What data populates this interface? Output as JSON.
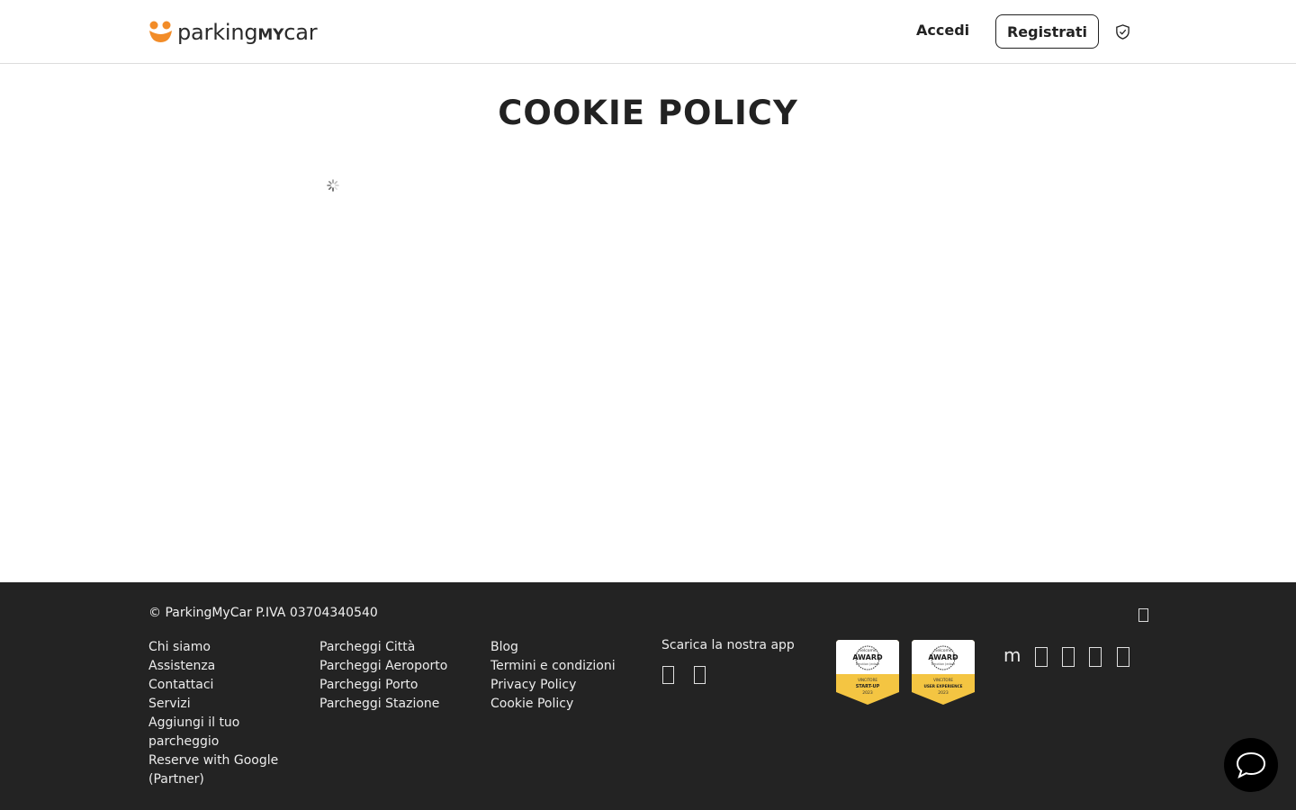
{
  "header": {
    "logo_light": "parking",
    "logo_bold": "MY",
    "logo_end": "car",
    "login_label": "Accedi",
    "register_label": "Registrati"
  },
  "main": {
    "title": "COOKIE POLICY"
  },
  "footer": {
    "copyright": "© ParkingMyCar P.IVA 03704340540",
    "col1": [
      "Chi siamo",
      "Assistenza",
      "Contattaci",
      "Servizi",
      "Aggiungi il tuo parcheggio",
      "Reserve with Google (Partner)"
    ],
    "col2": [
      "Parcheggi Città",
      "Parcheggi Aeroporto",
      "Parcheggi Porto",
      "Parcheggi Stazione"
    ],
    "col3": [
      "Blog",
      "Termini e condizioni",
      "Privacy Policy",
      "Cookie Policy"
    ],
    "app_title": "Scarica la nostra app",
    "badges": [
      {
        "top": "nelcome",
        "main": "AWARD",
        "sub": "Emotion Jedam",
        "ribbon": "VINCITORE",
        "category": "START-UP",
        "year": "2023"
      },
      {
        "top": "nelcome",
        "main": "AWARD",
        "sub": "Emotion Jedam",
        "ribbon": "VINCITORE",
        "category": "USER EXPERIENCE",
        "year": "2023"
      }
    ],
    "social_m": "m"
  },
  "colors": {
    "brand_orange": "#F28C28",
    "footer_bg": "#232323",
    "badge_gold": "#F4C542"
  }
}
